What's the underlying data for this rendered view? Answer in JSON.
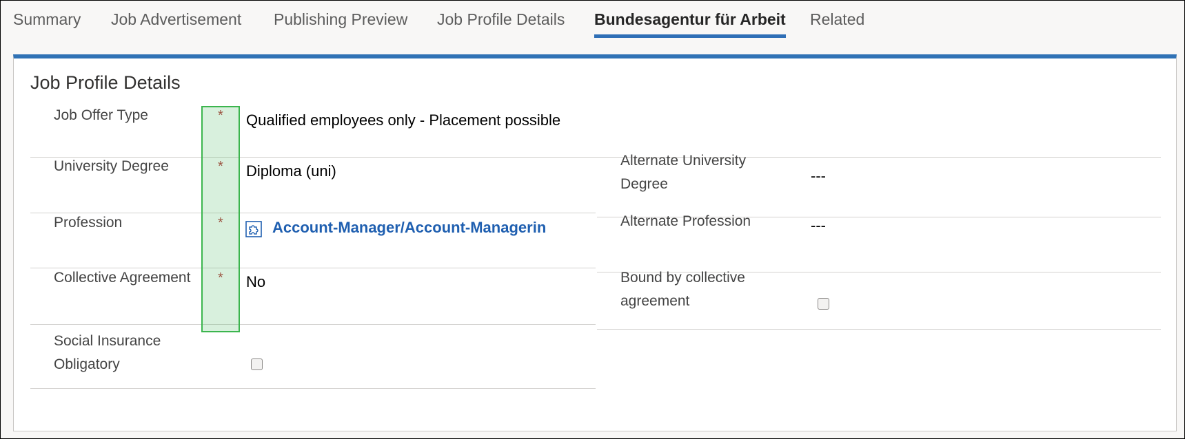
{
  "tabs": [
    {
      "label": "Summary"
    },
    {
      "label": "Job Advertisement"
    },
    {
      "label": "Publishing Preview"
    },
    {
      "label": "Job Profile Details"
    },
    {
      "label": "Bundesagentur für Arbeit"
    },
    {
      "label": "Related"
    }
  ],
  "section": {
    "title": "Job Profile Details",
    "required_mark": "*",
    "fields": {
      "job_offer_type": {
        "label": "Job Offer Type",
        "value": "Qualified employees only - Placement possible"
      },
      "university_degree": {
        "label": "University Degree",
        "value": "Diploma (uni)"
      },
      "profession": {
        "label": "Profession",
        "value": "Account-Manager/Account-Managerin"
      },
      "collective_agreement": {
        "label": "Collective Agreement",
        "value": "No"
      },
      "social_insurance": {
        "label_line1": "Social Insurance",
        "label_line2": "Obligatory"
      },
      "alt_university_degree": {
        "label_line1": "Alternate University",
        "label_line2": "Degree",
        "value": "---"
      },
      "alt_profession": {
        "label": "Alternate Profession",
        "value": "---"
      },
      "bound_collective": {
        "label_line1": "Bound by collective",
        "label_line2": "agreement"
      }
    }
  },
  "colors": {
    "accent": "#3072b5",
    "link": "#1f5fb0",
    "required": "#b33a3a",
    "highlight": "#3cb54e"
  },
  "icons": {
    "profession_lookup": "puzzle-icon"
  }
}
